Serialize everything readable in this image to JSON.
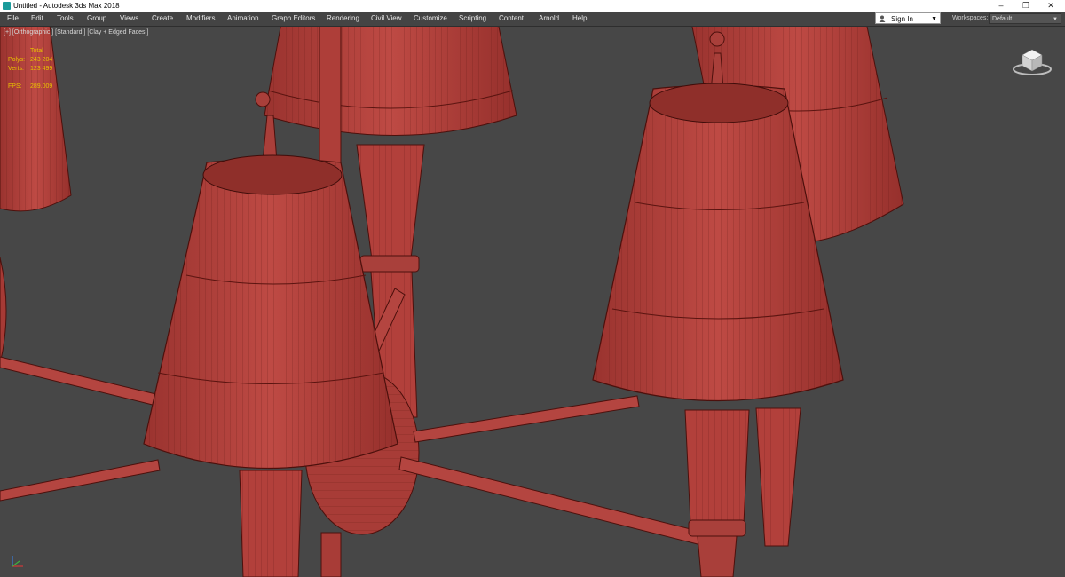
{
  "window": {
    "title": "Untitled - Autodesk 3ds Max 2018",
    "controls": {
      "minimize": "–",
      "restore": "❐",
      "close": "✕"
    }
  },
  "menu": {
    "items": [
      "File",
      "Edit",
      "Tools",
      "Group",
      "Views",
      "Create",
      "Modifiers",
      "Animation",
      "Graph Editors",
      "Rendering",
      "Civil View",
      "Customize",
      "Scripting",
      "Content",
      "Arnold",
      "Help"
    ]
  },
  "account": {
    "sign_in_label": "Sign In",
    "icon": "user-icon"
  },
  "workspaces": {
    "label": "Workspaces:",
    "value": "Default"
  },
  "viewport": {
    "label": "[+] [Orthographic ] [Standard ] [Clay + Edged Faces ]",
    "stats": {
      "header": "Total",
      "polys_label": "Polys:",
      "polys_value": "243 204",
      "verts_label": "Verts:",
      "verts_value": "123 499",
      "fps_label": "FPS:",
      "fps_value": "289.009"
    },
    "model_color": "#b4413c",
    "background_color": "#474747",
    "stat_color": "#e8c200"
  }
}
